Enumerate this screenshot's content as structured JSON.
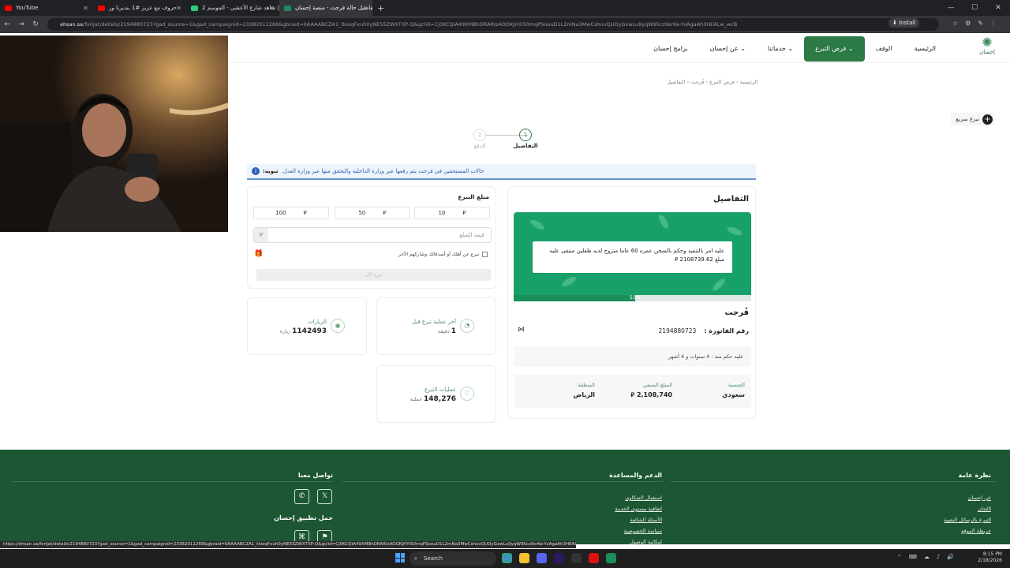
{
  "browser": {
    "tabs": [
      {
        "label": "YouTube",
        "color": "#ff0000"
      },
      {
        "label": "حروف مع عزيز #1 بنديرنا ور",
        "color": "#ff0000"
      },
      {
        "label": "شاهد شارع الأعشى - الموسم 2 |",
        "color": "#2ecc71"
      },
      {
        "label": "تفاصيل حالة فرجت - منصة إحسان",
        "color": "#1b8f5a",
        "active": true
      }
    ],
    "url_host": "ehsan.sa",
    "url_path": "/forijat/details/2194880723?gad_source=1&gad_campaignid=23382011268&gbraid=0AAAABCZA1_tkioqFxuh0yNE5SZWXTXP-Q&gclid=Cj0KCQiA49XMBhDRARIsAOOKJHYi50mqPSoouD1L2mNa3MwCshuvQUOyGxwLu9yqW95cz9srKe-YsAgaAh3HEALw_wcB",
    "install_label": "Install"
  },
  "site": {
    "logo_text": "إحسان",
    "nav": [
      "الرئيسية",
      "الوقف",
      "فرص التبرع",
      "خدماتنا",
      "عن إحسان",
      "برامج إحسان"
    ],
    "active_nav": "فرص التبرع",
    "breadcrumb": "الرئيسية  ›  فرص التبرع  ›  فُرجت  ›  التفاصيل",
    "quick_donate": "تبرع سريع",
    "steps": [
      {
        "num": "1",
        "label": "التفاصيل"
      },
      {
        "num": "2",
        "label": "الدفع"
      }
    ],
    "notice_title": "تنويه:",
    "notice_text": "حالات المستحقين في فرجت يتم رفعها عبر وزارة الداخلية والتحقق منها عبر وزارة العدل.",
    "amount": {
      "title": "مبلغ التبرع",
      "options": [
        "100",
        "50",
        "10"
      ],
      "currency": "⃁",
      "placeholder": "قيمة المبلغ",
      "gift_label": "تبرع عن أهلك أو أصدقائك وشاركهم الأجر",
      "donate_label": "تبرع الآن"
    },
    "stats": [
      {
        "label": "آخر عملية تبرع قبل",
        "value": "1",
        "unit": "دقيقة"
      },
      {
        "label": "الزيارات",
        "value": "1142493",
        "unit": "زيارة"
      },
      {
        "label": "عمليات التبرع",
        "value": "148,276",
        "unit": "عملية"
      }
    ],
    "details": {
      "title": "التفاصيل",
      "case_text": "عليه امر بالتنفيذ وحكم بالسجن عمره 60 عاما متزوج لديه طفلين متبقى عليه مبلغ 2108739.62 ⃁",
      "progress_pct": 51,
      "progress_label": "51%",
      "name": "فُرجت",
      "invoice_label": "رقم الفاتورة :",
      "invoice_no": "2194880723",
      "sentence": "عليه حكم منذ : 4 سنوات و 4 أشهر",
      "nationality_label": "الجنسية",
      "nationality": "سعودي",
      "remaining_label": "المبلغ المتبقي",
      "remaining": "2,108,740 ⃁",
      "region_label": "المنطقة",
      "region": "الرياض"
    },
    "footer": {
      "general_title": "نظرة عامة",
      "general_links": [
        "عن إحسان",
        "اللجان",
        "التبرع بالرسائل النصية",
        "خريطة الموقع"
      ],
      "support_title": "الدعم والمساعدة",
      "support_links": [
        "استقبال الشكاوى",
        "اتفاقية مستوى الخدمة",
        "الأسئلة الشائعة",
        "سياسة الخصوصية",
        "إمكانية الوصول"
      ],
      "contact_title": "تواصل معنا",
      "app_title": "حمل تطبيق إحسان"
    }
  },
  "status_url": "https://ehsan.sa/forijat/details/2194880723?gad_source=1&gad_campaignid=23382011268&gbraid=0AAAABCZA1_tkioqFxuh0yNE5SZWXTXP-Q&gclid=Cj0KCQiA49XMBhDRARIsAOOKJHYi50mqPSoouD1L2mNa3MwCshuvQUOyGxwLu9yqW95cz9srKe-YsAgaAh3HEALw_wcB#",
  "taskbar": {
    "search": "Search",
    "time": "8:15 PM",
    "date": "2/18/2026"
  },
  "colors": {
    "brand": "#2c7a46",
    "footer": "#1d5632",
    "banner": "#17a06a",
    "notice": "#2b62b5"
  }
}
